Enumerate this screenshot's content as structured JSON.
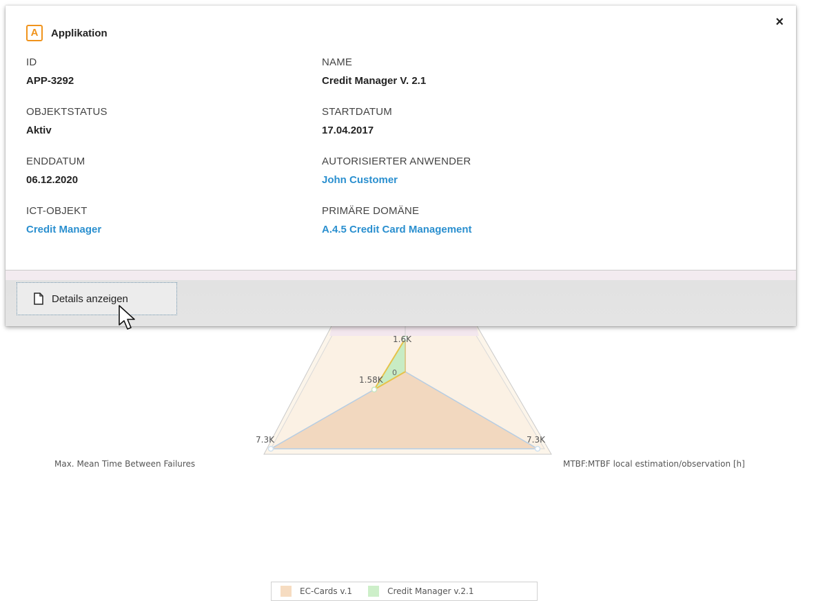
{
  "popup": {
    "type_icon": "A",
    "title": "Applikation",
    "close_icon": "×",
    "fields": [
      {
        "label": "ID",
        "value": "APP-3292",
        "is_link": false
      },
      {
        "label": "NAME",
        "value": "Credit Manager V. 2.1",
        "is_link": false
      },
      {
        "label": "OBJEKTSTATUS",
        "value": "Aktiv",
        "is_link": false
      },
      {
        "label": "STARTDATUM",
        "value": "17.04.2017",
        "is_link": false
      },
      {
        "label": "ENDDATUM",
        "value": "06.12.2020",
        "is_link": false
      },
      {
        "label": "AUTORISIERTER ANWENDER",
        "value": "John Customer",
        "is_link": true
      },
      {
        "label": "ICT-OBJEKT",
        "value": "Credit Manager",
        "is_link": true
      },
      {
        "label": "PRIMÄRE DOMÄNE",
        "value": "A.4.5 Credit Card Management",
        "is_link": true
      }
    ],
    "footer": {
      "details_button_label": "Details anzeigen",
      "details_icon": "document-icon"
    }
  },
  "colors": {
    "accent_orange": "#f0931b",
    "link_blue": "#2a8fcf",
    "series_ec_cards": "#f2d8bf",
    "series_credit_manager": "#c8ecc4"
  },
  "chart_data": {
    "type": "radar",
    "axes": [
      "",
      "MTBF:MTBF local estimation/observation [h]",
      "Max. Mean Time Between Failures"
    ],
    "value_labels": [
      "1.6K",
      "1.58K",
      "0",
      "7.3K",
      "7.3K"
    ],
    "series": [
      {
        "name": "EC-Cards v.1",
        "color": "#f2d8bf"
      },
      {
        "name": "Credit Manager v.2.1",
        "color": "#c8ecc4"
      }
    ],
    "legend_position": "bottom"
  }
}
